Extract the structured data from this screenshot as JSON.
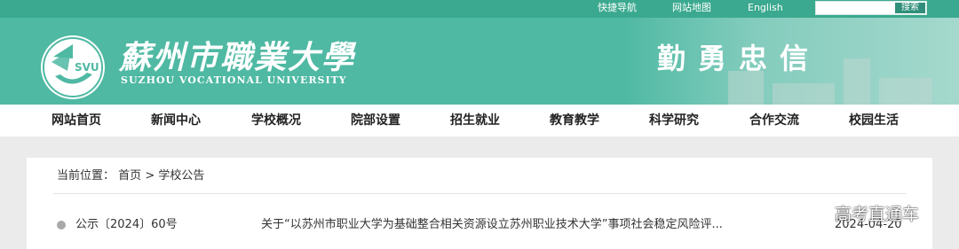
{
  "topbar": {
    "links": [
      {
        "label": "快捷导航"
      },
      {
        "label": "网站地图"
      },
      {
        "label": "English"
      }
    ],
    "search": {
      "placeholder": "",
      "button_label": "搜索"
    }
  },
  "header": {
    "logo_text": "SVU",
    "school_name_cn": "蘇州市職業大學",
    "school_name_en": "SUZHOU VOCATIONAL UNIVERSITY",
    "motto": "勤勇忠信"
  },
  "nav": {
    "items": [
      {
        "label": "网站首页"
      },
      {
        "label": "新闻中心"
      },
      {
        "label": "学校概况"
      },
      {
        "label": "院部设置"
      },
      {
        "label": "招生就业"
      },
      {
        "label": "教育教学"
      },
      {
        "label": "科学研究"
      },
      {
        "label": "合作交流"
      },
      {
        "label": "校园生活"
      }
    ]
  },
  "breadcrumb": {
    "prefix": "当前位置：",
    "home": "首页",
    "separator": ">",
    "current": "学校公告"
  },
  "notices": [
    {
      "number": "公示〔2024〕60号",
      "title": "关于“以苏州市职业大学为基础整合相关资源设立苏州职业技术大学”事项社会稳定风险评...",
      "date": "2024-04-20"
    }
  ],
  "watermark": "高考直通车",
  "colors": {
    "topbar": "#3aa98f",
    "banner": "#4fb9a3",
    "nav_bg": "#ffffff",
    "page_bg": "#ebebeb"
  }
}
